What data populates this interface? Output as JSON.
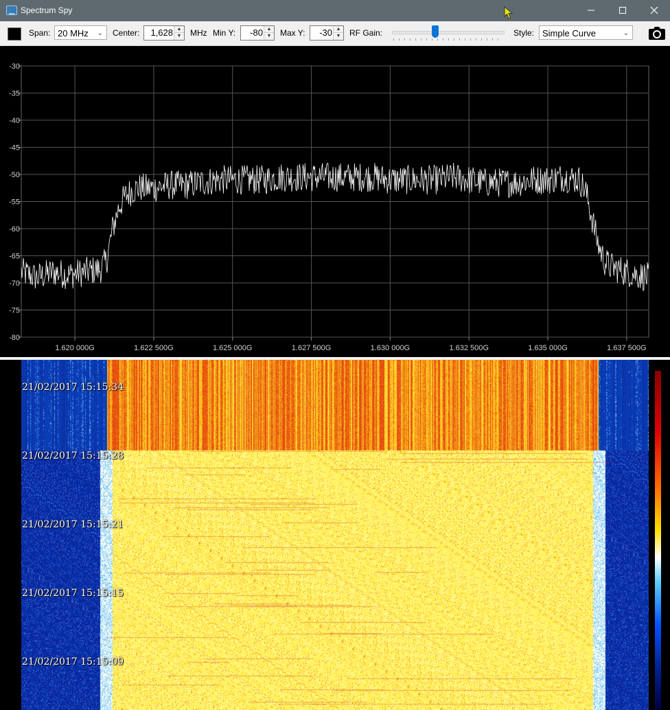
{
  "window": {
    "title": "Spectrum Spy",
    "minimize_icon": "minimize-icon",
    "maximize_icon": "maximize-icon",
    "close_icon": "close-icon"
  },
  "toolbar": {
    "color_swatch": "#000000",
    "span_label": "Span:",
    "span_value": "20 MHz",
    "center_label": "Center:",
    "center_value": "1,628",
    "center_unit": "MHz",
    "miny_label": "Min Y:",
    "miny_value": "-80",
    "maxy_label": "Max Y:",
    "maxy_value": "-30",
    "rfgain_label": "RF Gain:",
    "rfgain_level_fraction": 0.38,
    "style_label": "Style:",
    "style_value": "Simple Curve",
    "camera_icon": "camera-icon"
  },
  "chart_data": {
    "type": "line",
    "title": "",
    "xlabel": "",
    "ylabel": "",
    "xlim": [
      1618.3,
      1638.2
    ],
    "ylim": [
      -80,
      -30
    ],
    "yticks": [
      -30,
      -35,
      -40,
      -45,
      -50,
      -55,
      -60,
      -65,
      -70,
      -75,
      -80
    ],
    "xticks": [
      1620.0,
      1622.5,
      1625.0,
      1627.5,
      1630.0,
      1632.5,
      1635.0,
      1637.5
    ],
    "xtick_labels": [
      "1.620 000G",
      "1.622 500G",
      "1.625 000G",
      "1.627 500G",
      "1.630 000G",
      "1.632 500G",
      "1.635 000G",
      "1.637 500G"
    ],
    "grid": true,
    "background": "#000000",
    "line_color": "#ffffff",
    "series": [
      {
        "x": [
          1618.3,
          1618.8,
          1619.3,
          1619.8,
          1620.3,
          1620.8,
          1621.0,
          1621.2,
          1621.4,
          1621.6,
          1621.8,
          1622.0,
          1622.5,
          1623.0,
          1623.5,
          1624.0,
          1624.5,
          1625.0,
          1625.5,
          1626.0,
          1626.5,
          1627.0,
          1627.5,
          1628.0,
          1628.5,
          1629.0,
          1629.5,
          1630.0,
          1630.5,
          1631.0,
          1631.5,
          1632.0,
          1632.5,
          1633.0,
          1633.5,
          1634.0,
          1634.5,
          1635.0,
          1635.5,
          1636.0,
          1636.2,
          1636.4,
          1636.6,
          1636.8,
          1637.0,
          1637.5,
          1638.2
        ],
        "y": [
          -68,
          -69,
          -68,
          -68.5,
          -68,
          -67.5,
          -66,
          -60,
          -56,
          -54,
          -53,
          -52.5,
          -52.5,
          -52,
          -52,
          -51.5,
          -51,
          -51,
          -51,
          -51,
          -50.5,
          -50.5,
          -50.5,
          -50.5,
          -50.5,
          -50.5,
          -50.5,
          -51,
          -51,
          -51,
          -51,
          -50.5,
          -51,
          -51.5,
          -51.5,
          -51.5,
          -51,
          -51,
          -50.5,
          -51,
          -53,
          -58,
          -63,
          -66,
          -67,
          -68,
          -69
        ]
      }
    ]
  },
  "waterfall": {
    "timestamps": [
      "21/02/2017 15:15:34",
      "21/02/2017 15:15:28",
      "21/02/2017 15:15:21",
      "21/02/2017 15:15:15",
      "21/02/2017 15:15:09"
    ],
    "signal_start_mhz": 1621.0,
    "signal_end_mhz": 1636.6,
    "colors": {
      "noise": "#0a2aa8",
      "signal": "#ffe930",
      "high": "#e83b10"
    }
  }
}
